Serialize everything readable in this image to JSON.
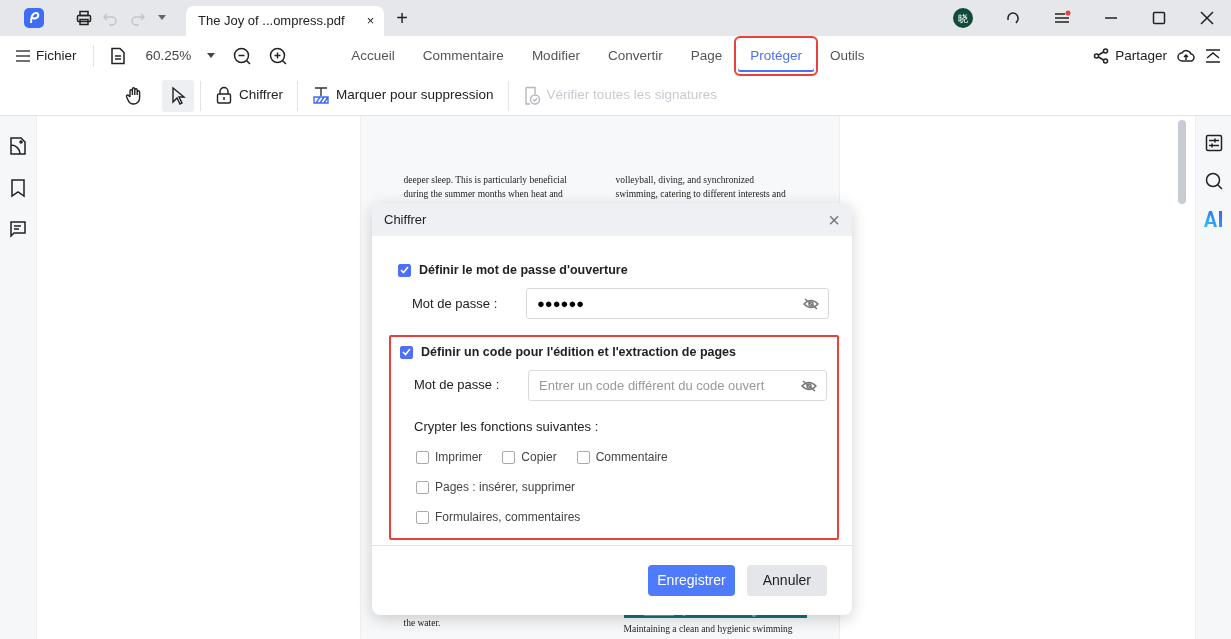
{
  "titlebar": {
    "tab_title": "The Joy of ...ompress.pdf",
    "tab_close": "×",
    "new_tab": "+",
    "avatar": "晓",
    "menu_notification": true
  },
  "menubar": {
    "file_label": "Fichier",
    "zoom": "60.25%",
    "share": "Partager",
    "tabs": [
      {
        "label": "Accueil",
        "selected": false,
        "highlighted": false
      },
      {
        "label": "Commentaire",
        "selected": false,
        "highlighted": false
      },
      {
        "label": "Modifier",
        "selected": false,
        "highlighted": false
      },
      {
        "label": "Convertir",
        "selected": false,
        "highlighted": false
      },
      {
        "label": "Page",
        "selected": false,
        "highlighted": false
      },
      {
        "label": "Protéger",
        "selected": true,
        "highlighted": true
      },
      {
        "label": "Outils",
        "selected": false,
        "highlighted": false
      }
    ]
  },
  "toolbar": {
    "tools": [
      {
        "kind": "hand",
        "selected": false
      },
      {
        "kind": "select",
        "selected": true
      }
    ],
    "actions": [
      {
        "kind": "lock",
        "label": "Chiffrer",
        "disabled": false
      },
      {
        "kind": "redact",
        "label": "Marquer pour suppression",
        "disabled": false
      },
      {
        "kind": "verify",
        "label": "Vérifier toutes les signatures",
        "disabled": true
      }
    ]
  },
  "document": {
    "top_left": [
      "deeper sleep. This is particularly beneficial",
      "during the summer months when heat and"
    ],
    "top_right": [
      "volleyball, diving, and synchronized",
      "swimming, catering to different interests and"
    ],
    "bottom_left": [
      "the water."
    ],
    "bottom_right": [
      "Maintaining a clean and hygienic swimming"
    ]
  },
  "dialog": {
    "title": "Chiffrer",
    "close": "×",
    "sections": [
      {
        "label": "Définir le mot de passe d'ouverture",
        "checked": true,
        "highlighted": false,
        "password_label": "Mot de passe :",
        "value": "●●●●●●"
      },
      {
        "label": "Définir un code pour l'édition et l'extraction de pages",
        "checked": true,
        "highlighted": true,
        "password_label": "Mot de passe :",
        "placeholder": "Entrer un code différent du code ouvert",
        "permissions_title": "Crypter les fonctions suivantes :",
        "permissions": [
          [
            {
              "label": "Imprimer",
              "checked": false
            },
            {
              "label": "Copier",
              "checked": false
            },
            {
              "label": "Commentaire",
              "checked": false
            }
          ],
          [
            {
              "label": "Pages : insérer, supprimer",
              "checked": false
            }
          ],
          [
            {
              "label": "Formulaires, commentaires",
              "checked": false
            }
          ]
        ]
      }
    ],
    "buttons": [
      {
        "label": "Enregistrer",
        "kind": "primary"
      },
      {
        "label": "Annuler",
        "kind": "secondary"
      }
    ]
  }
}
